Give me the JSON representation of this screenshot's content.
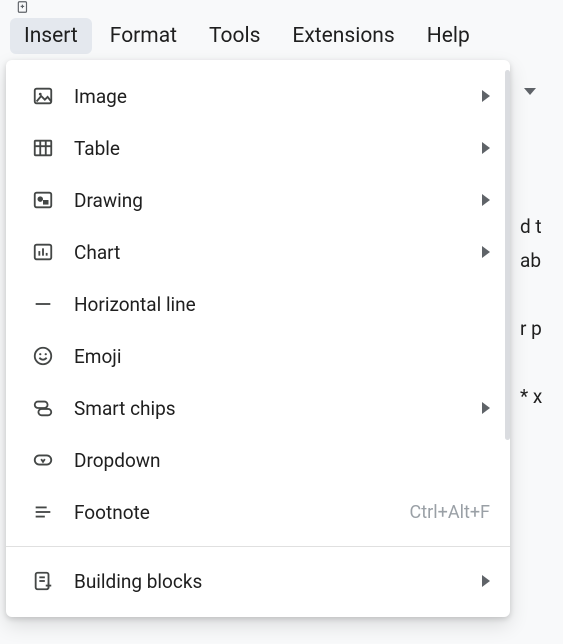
{
  "menubar": {
    "items": [
      {
        "label": "Insert",
        "active": true
      },
      {
        "label": "Format",
        "active": false
      },
      {
        "label": "Tools",
        "active": false
      },
      {
        "label": "Extensions",
        "active": false
      },
      {
        "label": "Help",
        "active": false
      }
    ]
  },
  "insert_menu": {
    "items": [
      {
        "icon": "image-icon",
        "label": "Image",
        "submenu": true,
        "shortcut": ""
      },
      {
        "icon": "table-icon",
        "label": "Table",
        "submenu": true,
        "shortcut": ""
      },
      {
        "icon": "drawing-icon",
        "label": "Drawing",
        "submenu": true,
        "shortcut": ""
      },
      {
        "icon": "chart-icon",
        "label": "Chart",
        "submenu": true,
        "shortcut": ""
      },
      {
        "icon": "horizontal-line-icon",
        "label": "Horizontal line",
        "submenu": false,
        "shortcut": ""
      },
      {
        "icon": "emoji-icon",
        "label": "Emoji",
        "submenu": false,
        "shortcut": ""
      },
      {
        "icon": "smart-chips-icon",
        "label": "Smart chips",
        "submenu": true,
        "shortcut": ""
      },
      {
        "icon": "dropdown-icon",
        "label": "Dropdown",
        "submenu": false,
        "shortcut": ""
      },
      {
        "icon": "footnote-icon",
        "label": "Footnote",
        "submenu": false,
        "shortcut": "Ctrl+Alt+F"
      }
    ],
    "after_divider": [
      {
        "icon": "building-blocks-icon",
        "label": "Building blocks",
        "submenu": true,
        "shortcut": ""
      }
    ]
  },
  "doc_fragment": "d t\nab\n\nr p\n\n* x"
}
